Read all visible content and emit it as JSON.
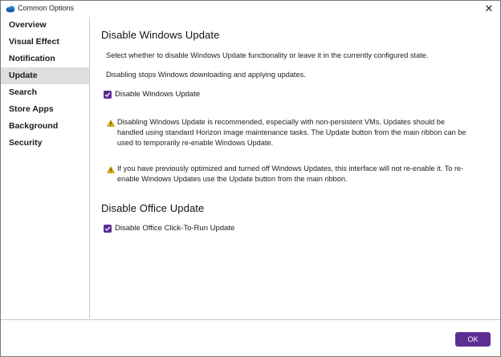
{
  "window": {
    "title": "Common Options",
    "close_glyph": "✕"
  },
  "sidebar": {
    "items": [
      {
        "label": "Overview"
      },
      {
        "label": "Visual Effect"
      },
      {
        "label": "Notification"
      },
      {
        "label": "Update",
        "selected": true
      },
      {
        "label": "Search"
      },
      {
        "label": "Store Apps"
      },
      {
        "label": "Background"
      },
      {
        "label": "Security"
      }
    ]
  },
  "main": {
    "windows_update": {
      "heading": "Disable Windows Update",
      "intro": "Select whether to disable Windows Update functionality or leave it in the currently configured state.",
      "description": "Disabling stops Windows downloading and applying updates.",
      "checkbox_label": "Disable Windows Update",
      "checked": true,
      "warning1_line1": "Disabling Windows Update is recommended, especially with non-persistent VMs. Updates should be",
      "warning1_line2": "handled using standard Horizon image maintenance tasks. The Update button from the main ribbon can be",
      "warning1_line3": "used to temporarily re-enable Windows Update.",
      "warning2_line1": "If you have previously optimized and turned off Windows Updates, this interface will not re-enable it. To re-",
      "warning2_line2": "enable Windows Updates use the Update button from the main ribbon."
    },
    "office_update": {
      "heading": "Disable Office Update",
      "checkbox_label": "Disable Office Click-To-Run Update",
      "checked": true
    }
  },
  "footer": {
    "ok_label": "OK"
  },
  "colors": {
    "accent": "#5c2d91",
    "warning": "#e0b400",
    "selected_bg": "#dedede"
  },
  "icons": {
    "app": "cloud-icon",
    "warning": "warning-icon",
    "check": "checkmark-icon",
    "close": "close-icon"
  }
}
